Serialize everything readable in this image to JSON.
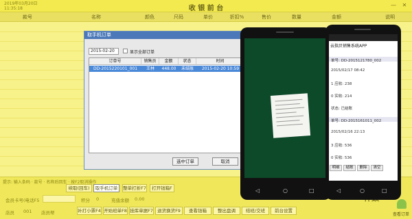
{
  "window": {
    "date": "2019年03月20日",
    "time": "11:35:18",
    "title": "收 银 前 台"
  },
  "columns": [
    "款号",
    "名称",
    "颜色",
    "尺码",
    "单价",
    "折扣%",
    "售价",
    "数量",
    "金额",
    "说明"
  ],
  "hint": "提示: 输入条码 · 款号 · 名称后回车 · 按F2取消操作",
  "toolbar": {
    "btn1": "续取(回车)",
    "btn2": "取手机订单",
    "btn3": "整单打折F7",
    "btn4": "打开钱箱F"
  },
  "fields": {
    "member": "会员卡号(电话F5",
    "points_label": "积分",
    "points": "0",
    "balance_label": "充值余额",
    "balance": "0.00",
    "pieces_label": "件数",
    "pieces": "0",
    "sales_label": "店员",
    "sales": "001",
    "staff": "店员帮"
  },
  "functions": [
    "补打小票F4",
    "开始班单F8",
    "挂库单据F7",
    "退货换货F9",
    "查看钱箱",
    "整出盘调",
    "结班/交班",
    "前台设置"
  ],
  "dialog": {
    "title": "取手机订单",
    "date": "2015-02-20",
    "show_all_label": "显示全部订单",
    "headers": [
      "订单号",
      "销售员",
      "金额",
      "状态",
      "时间"
    ],
    "rows": [
      [
        "DD-2015220101_001",
        "王林",
        "448.00",
        "未结账",
        "2015-02-20 10:59"
      ]
    ],
    "btn_select": "选中订单",
    "btn_cancel": "取消"
  },
  "phone2": {
    "app_title": "云指贝销售系统APP",
    "orders": [
      {
        "id": "单号: DD-2015121780_002",
        "date": "2015/02/17 08:42",
        "qty": "1  应收: 238",
        "paid": "0  实收: 214",
        "status": "状态: 已结账"
      },
      {
        "id": "单号: DD-2015161011_002",
        "date": "2015/02/16 22:13",
        "qty": "3  应收: 536",
        "paid": "0  实收: 536"
      }
    ],
    "buttons": [
      "明细",
      "结账",
      "删除",
      "清空"
    ]
  },
  "android_label": "查看订单"
}
